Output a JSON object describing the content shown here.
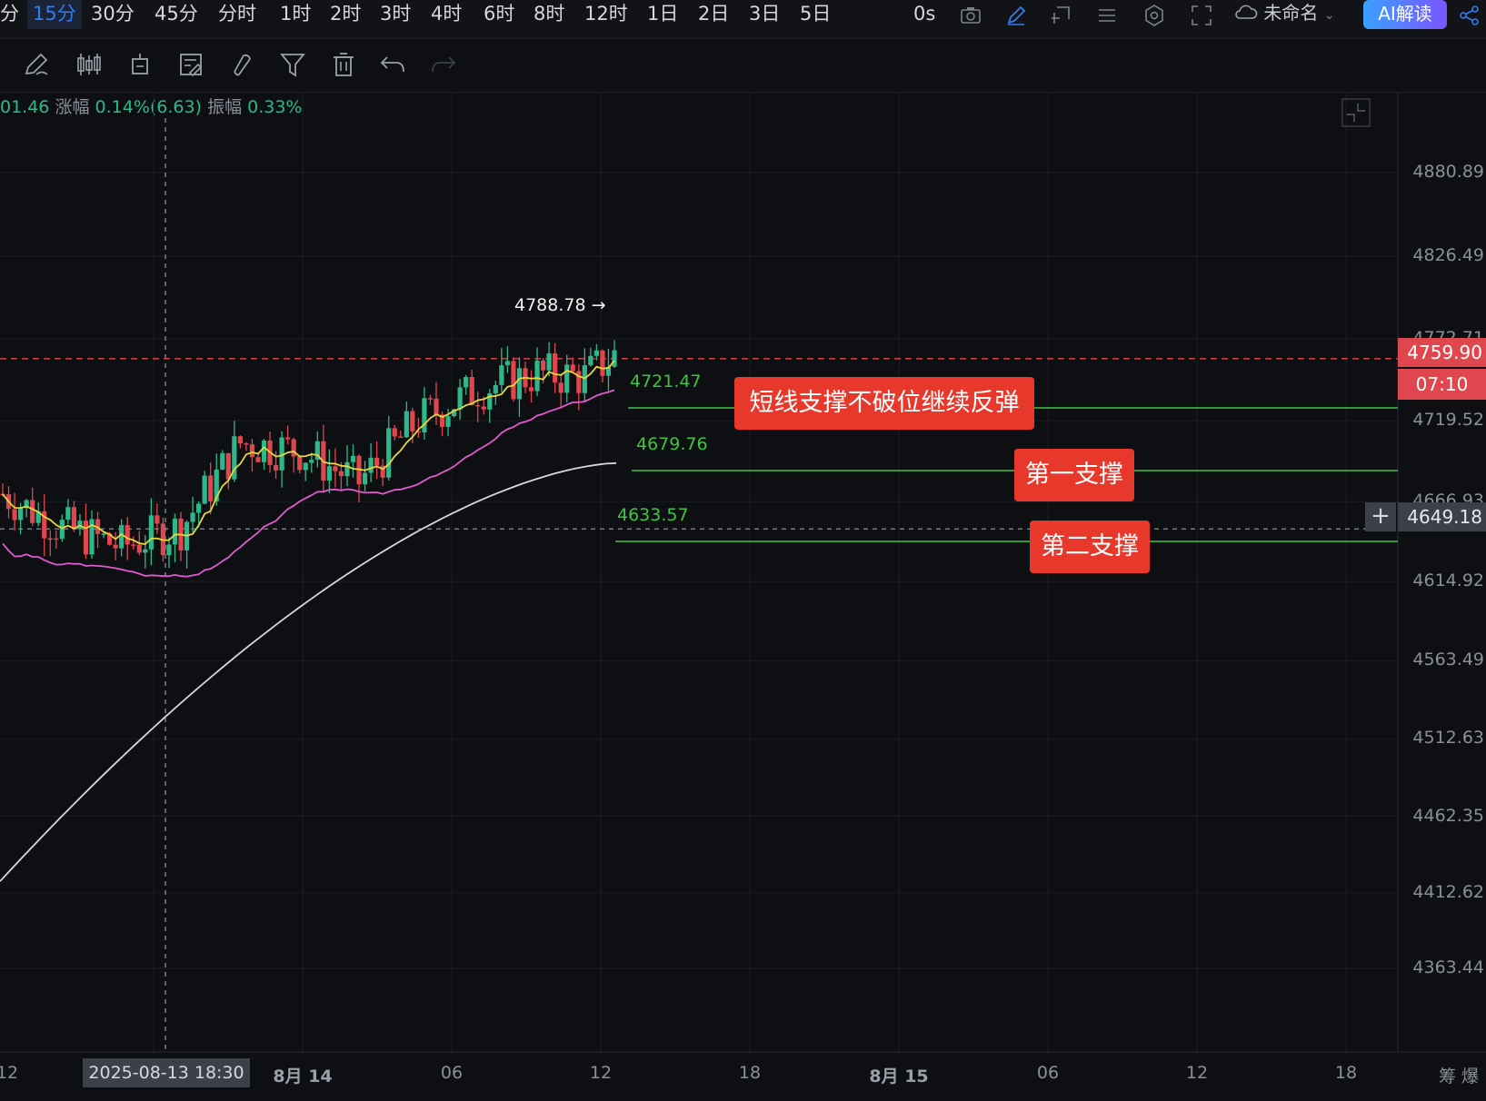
{
  "timeframes": [
    "分",
    "15分",
    "30分",
    "45分",
    "分时",
    "1时",
    "2时",
    "3时",
    "4时",
    "6时",
    "8时",
    "12时",
    "1日",
    "2日",
    "3日",
    "5日"
  ],
  "active_timeframe": "15分",
  "countdown_label": "0s",
  "workspace_name": "未命名",
  "ai_button": "AI解读",
  "tools": [
    "pencil-icon",
    "candles-icon",
    "indicator-icon",
    "template-icon",
    "magnet-icon",
    "filter-icon",
    "trash-icon",
    "undo-icon",
    "redo-icon"
  ],
  "info_bar": {
    "price_tail": "01.46",
    "change_label": "涨幅",
    "change_value": "0.14%(6.63)",
    "amp_label": "振幅",
    "amp_value": "0.33%"
  },
  "price_axis": [
    "4880.89",
    "4826.49",
    "4772.71",
    "4719.52",
    "4666.93",
    "4614.92",
    "4563.49",
    "4512.63",
    "4462.35",
    "4412.62",
    "4363.44"
  ],
  "current_price": "4759.90",
  "bar_countdown": "07:10",
  "crosshair_price": "4649.18",
  "crosshair_time": "2025-08-13 18:30",
  "time_axis": [
    {
      "label": "12",
      "bold": false
    },
    {
      "label": "8月 14",
      "bold": true
    },
    {
      "label": "06",
      "bold": false
    },
    {
      "label": "12",
      "bold": false
    },
    {
      "label": "18",
      "bold": false
    },
    {
      "label": "8月 15",
      "bold": true
    },
    {
      "label": "06",
      "bold": false
    },
    {
      "label": "12",
      "bold": false
    },
    {
      "label": "18",
      "bold": false
    }
  ],
  "axis_corner": "筹 爆",
  "high_label": "4788.78",
  "levels": {
    "short_support": {
      "price": "4721.47",
      "note": "短线支撑不破位继续反弹"
    },
    "first_support": {
      "price": "4679.76",
      "note": "第一支撑"
    },
    "second_support": {
      "price": "4633.57",
      "note": "第二支撑"
    }
  },
  "colors": {
    "up": "#2eb88a",
    "down": "#e0464e",
    "ma_short": "#e8d63a",
    "ma_mid": "#e05ad0",
    "ma_long": "#d8d8d8",
    "support": "#3ec43e",
    "tag": "#e8382c",
    "accent": "#2f7cf6"
  },
  "chart_data": {
    "type": "candlestick",
    "y_scale": "price",
    "ylim": [
      4330,
      4925
    ],
    "highest": 4788.78,
    "last_price": 4759.9,
    "moving_averages": [
      "short (yellow)",
      "mid (magenta)",
      "long (white)"
    ],
    "horizontal_levels": [
      4721.47,
      4679.76,
      4633.57
    ]
  }
}
